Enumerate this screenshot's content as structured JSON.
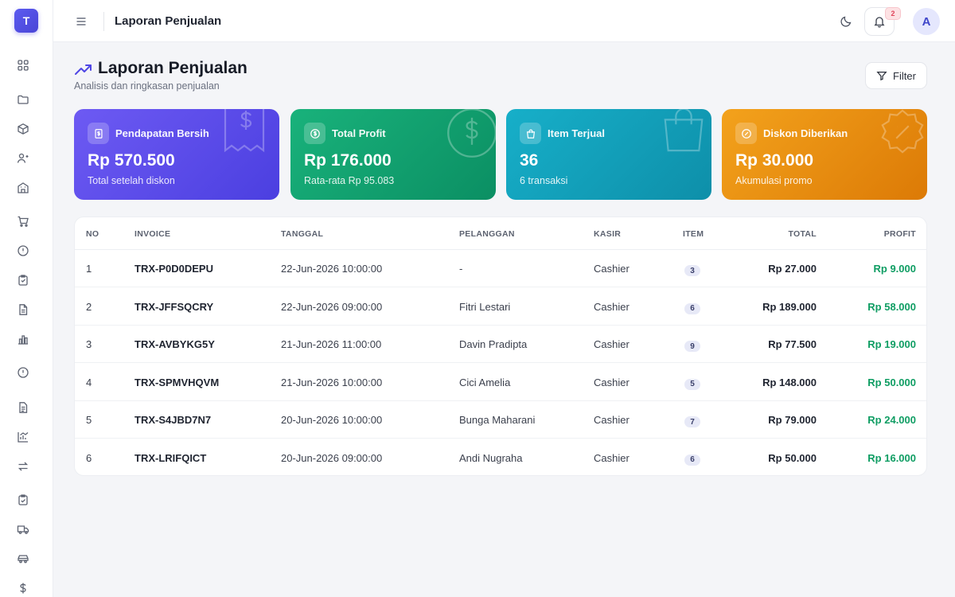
{
  "app": {
    "logo_letter": "T"
  },
  "topbar": {
    "title": "Laporan Penjualan",
    "notification_count": "2",
    "avatar_letter": "A"
  },
  "sidebar": {
    "icons": [
      "grid-icon",
      "folder-icon",
      "box-icon",
      "users-icon",
      "building-icon",
      "cart-icon",
      "alert-circle-icon",
      "clipboard-icon",
      "file-icon",
      "bar-chart-icon",
      "info-icon",
      "document-icon",
      "trend-chart-icon",
      "transfer-icon",
      "checklist-icon",
      "truck-icon",
      "car-icon",
      "dollar-icon"
    ]
  },
  "page": {
    "title": "Laporan Penjualan",
    "subtitle": "Analisis dan ringkasan penjualan",
    "filter_label": "Filter"
  },
  "cards": [
    {
      "label": "Pendapatan Bersih",
      "value": "Rp 570.500",
      "note": "Total setelah diskon"
    },
    {
      "label": "Total Profit",
      "value": "Rp 176.000",
      "note": "Rata-rata Rp 95.083"
    },
    {
      "label": "Item Terjual",
      "value": "36",
      "note": "6 transaksi"
    },
    {
      "label": "Diskon Diberikan",
      "value": "Rp 30.000",
      "note": "Akumulasi promo"
    }
  ],
  "table": {
    "headers": {
      "no": "NO",
      "invoice": "INVOICE",
      "tanggal": "TANGGAL",
      "pelanggan": "PELANGGAN",
      "kasir": "KASIR",
      "item": "ITEM",
      "total": "TOTAL",
      "profit": "PROFIT"
    },
    "rows": [
      {
        "no": "1",
        "invoice": "TRX-P0D0DEPU",
        "tanggal": "22-Jun-2026 10:00:00",
        "pelanggan": "-",
        "kasir": "Cashier",
        "item": "3",
        "total": "Rp 27.000",
        "profit": "Rp 9.000"
      },
      {
        "no": "2",
        "invoice": "TRX-JFFSQCRY",
        "tanggal": "22-Jun-2026 09:00:00",
        "pelanggan": "Fitri Lestari",
        "kasir": "Cashier",
        "item": "6",
        "total": "Rp 189.000",
        "profit": "Rp 58.000"
      },
      {
        "no": "3",
        "invoice": "TRX-AVBYKG5Y",
        "tanggal": "21-Jun-2026 11:00:00",
        "pelanggan": "Davin Pradipta",
        "kasir": "Cashier",
        "item": "9",
        "total": "Rp 77.500",
        "profit": "Rp 19.000"
      },
      {
        "no": "4",
        "invoice": "TRX-SPMVHQVM",
        "tanggal": "21-Jun-2026 10:00:00",
        "pelanggan": "Cici Amelia",
        "kasir": "Cashier",
        "item": "5",
        "total": "Rp 148.000",
        "profit": "Rp 50.000"
      },
      {
        "no": "5",
        "invoice": "TRX-S4JBD7N7",
        "tanggal": "20-Jun-2026 10:00:00",
        "pelanggan": "Bunga Maharani",
        "kasir": "Cashier",
        "item": "7",
        "total": "Rp 79.000",
        "profit": "Rp 24.000"
      },
      {
        "no": "6",
        "invoice": "TRX-LRIFQICT",
        "tanggal": "20-Jun-2026 09:00:00",
        "pelanggan": "Andi Nugraha",
        "kasir": "Cashier",
        "item": "6",
        "total": "Rp 50.000",
        "profit": "Rp 16.000"
      }
    ]
  },
  "colors": {
    "accent": "#4f46e5",
    "profit": "#0f9d63",
    "card1": "#5b4ee8",
    "card2": "#12a26f",
    "card3": "#139fb9",
    "card4": "#e88d10"
  }
}
